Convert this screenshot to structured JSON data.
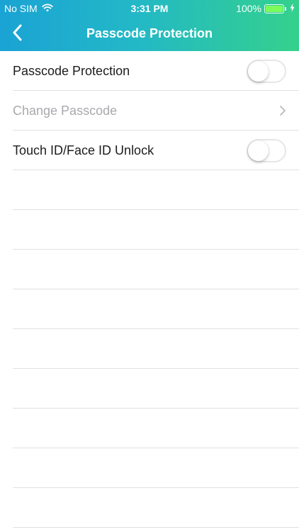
{
  "status_bar": {
    "carrier": "No SIM",
    "time": "3:31 PM",
    "battery_percent": "100%",
    "battery_level": 1.0,
    "icons": [
      "wifi-icon",
      "battery-icon",
      "charging-bolt-icon"
    ]
  },
  "nav": {
    "title": "Passcode Protection",
    "back_icon": "chevron-left-icon"
  },
  "settings": {
    "items": [
      {
        "label": "Passcode Protection",
        "control": "toggle",
        "on": false
      },
      {
        "label": "Change Passcode",
        "control": "disclosure",
        "enabled": false
      },
      {
        "label": "Touch ID/Face ID Unlock",
        "control": "toggle",
        "on": false
      }
    ]
  },
  "colors": {
    "header_gradient_start": "#1aa3d4",
    "header_gradient_end": "#34d18c",
    "disabled_text": "#a9a9ae",
    "battery_fill": "#7CFC5A"
  }
}
